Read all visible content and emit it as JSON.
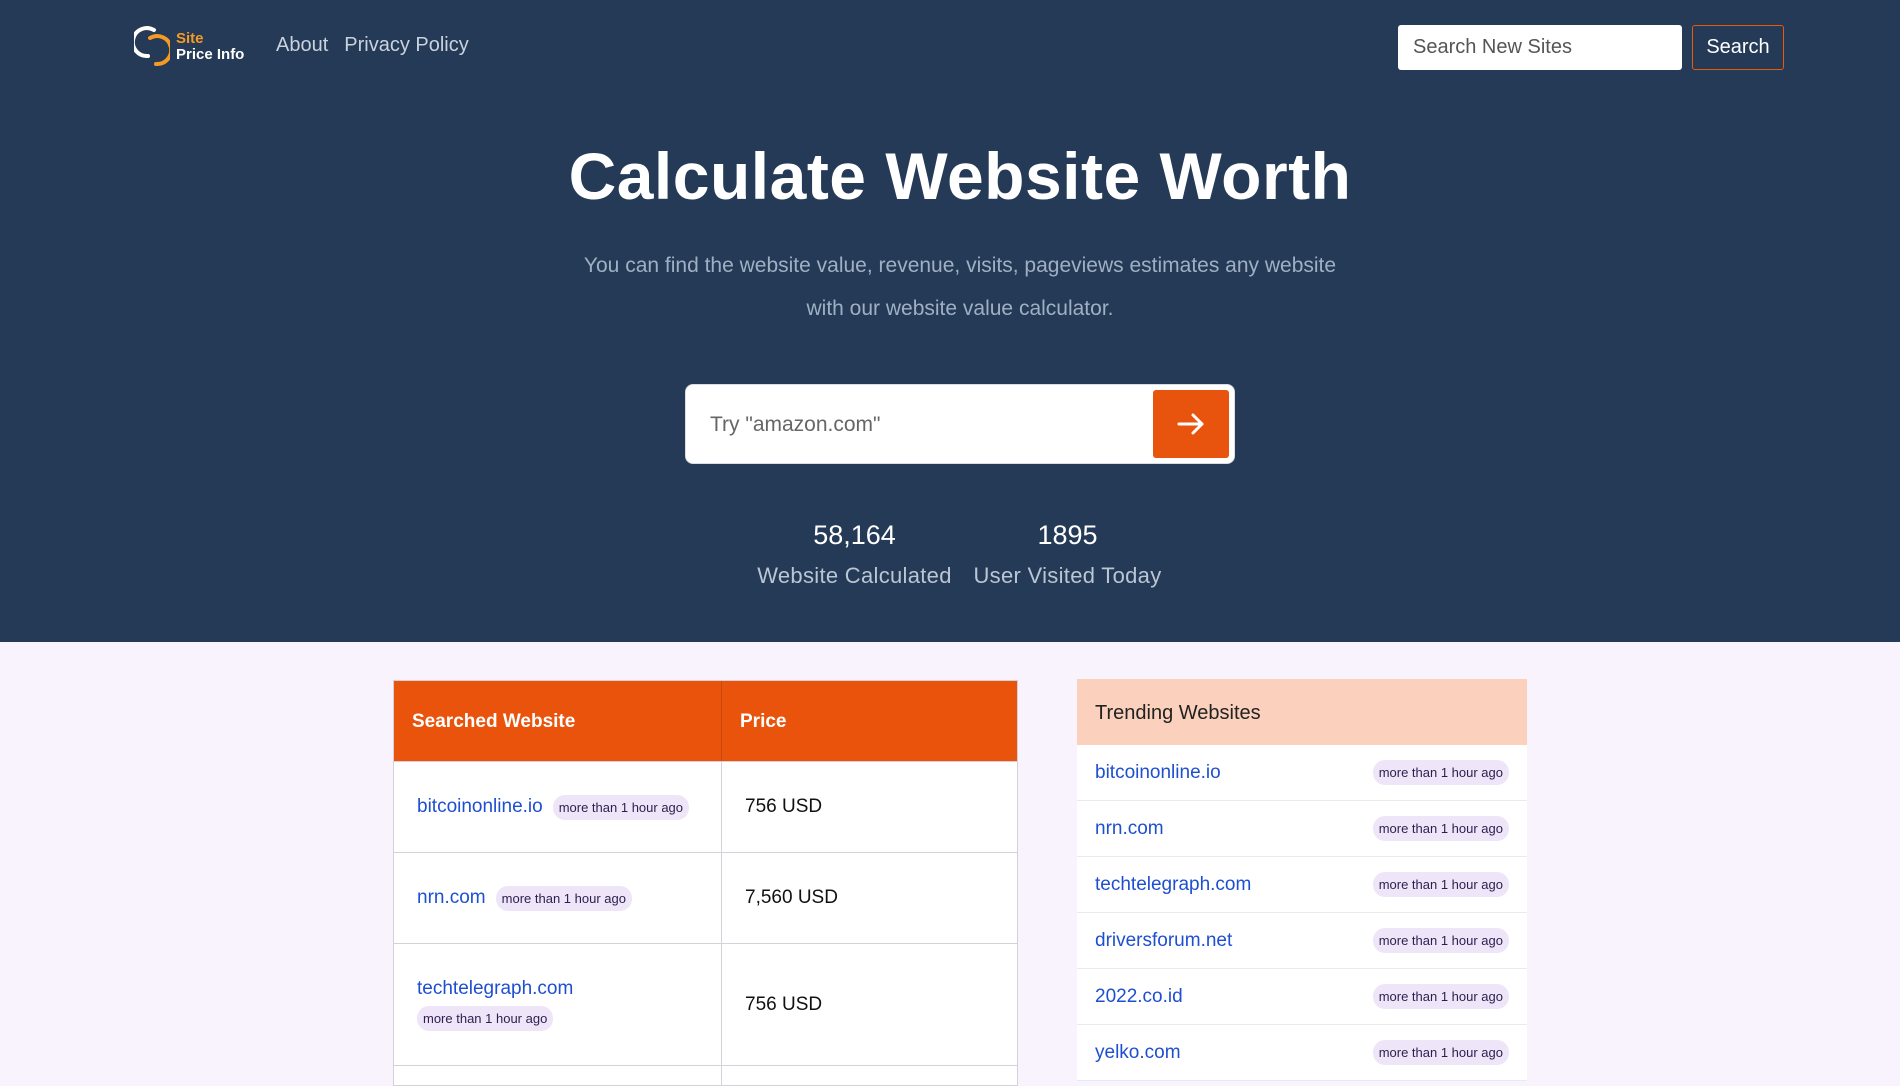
{
  "brand": {
    "line1": "Site",
    "line2": "Price Info"
  },
  "nav": {
    "links": [
      "About",
      "Privacy Policy"
    ],
    "search_placeholder": "Search New Sites",
    "search_button": "Search"
  },
  "hero": {
    "title": "Calculate Website Worth",
    "subtitle_line1": "You can find the website value, revenue, visits, pageviews estimates any website",
    "subtitle_line2": "with our website value calculator.",
    "input_placeholder": "Try \"amazon.com\"",
    "go_icon": "arrow-right-icon"
  },
  "stats": [
    {
      "value": "58,164",
      "label": "Website Calculated"
    },
    {
      "value": "1895",
      "label": "User Visited Today"
    }
  ],
  "searched_table": {
    "headers": [
      "Searched Website",
      "Price"
    ],
    "rows": [
      {
        "site": "bitcoinonline.io",
        "time": "more than 1 hour ago",
        "price": "756 USD"
      },
      {
        "site": "nrn.com",
        "time": "more than 1 hour ago",
        "price": "7,560 USD"
      },
      {
        "site": "techtelegraph.com",
        "time": "more than 1 hour ago",
        "price": "756 USD"
      }
    ]
  },
  "trending": {
    "title": "Trending Websites",
    "items": [
      {
        "site": "bitcoinonline.io",
        "time": "more than 1 hour ago"
      },
      {
        "site": "nrn.com",
        "time": "more than 1 hour ago"
      },
      {
        "site": "techtelegraph.com",
        "time": "more than 1 hour ago"
      },
      {
        "site": "driversforum.net",
        "time": "more than 1 hour ago"
      },
      {
        "site": "2022.co.id",
        "time": "more than 1 hour ago"
      },
      {
        "site": "yelko.com",
        "time": "more than 1 hour ago"
      }
    ]
  },
  "colors": {
    "hero_bg": "#243a56",
    "accent": "#ea530c",
    "trending_header": "#fbd0bc",
    "page_bg": "#f8f3fc"
  }
}
